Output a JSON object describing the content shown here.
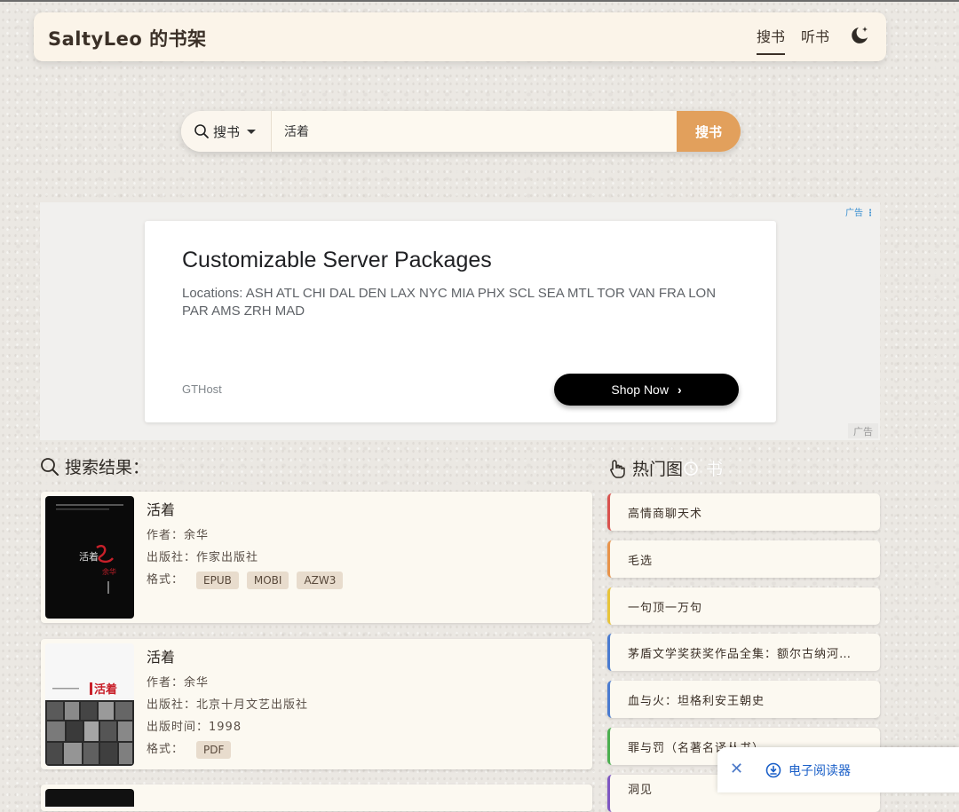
{
  "header": {
    "brand": "SaltyLeo 的书架",
    "nav": [
      {
        "label": "搜书",
        "active": true
      },
      {
        "label": "听书",
        "active": false
      }
    ],
    "theme_icon": "moon-icon"
  },
  "search": {
    "type_label": "搜书",
    "query": "活着",
    "button_label": "搜书"
  },
  "ad": {
    "top_badge": "广告",
    "title": "Customizable Server Packages",
    "description": "Locations: ASH ATL CHI DAL DEN LAX NYC MIA PHX SCL SEA MTL TOR VAN FRA LON PAR AMS ZRH MAD",
    "advertiser": "GTHost",
    "cta": "Shop Now",
    "bottom_badge": "广告"
  },
  "results": {
    "title": "搜索结果：",
    "books": [
      {
        "title": "活着",
        "author": "作者：余华",
        "publisher": "出版社：作家出版社",
        "format_label": "格式：",
        "formats": [
          "EPUB",
          "MOBI",
          "AZW3"
        ],
        "cover": {
          "title": "活着",
          "signature": "余华"
        }
      },
      {
        "title": "活着",
        "author": "作者：余华",
        "publisher": "出版社：北京十月文艺出版社",
        "date": "出版时间：1998",
        "format_label": "格式：",
        "formats": [
          "PDF"
        ],
        "cover": {
          "title": "活着"
        }
      }
    ]
  },
  "hot": {
    "title_main": "热门图",
    "title_faded": "书",
    "items": [
      {
        "label": "高情商聊天术",
        "color": "#d9534f"
      },
      {
        "label": "毛选",
        "color": "#e8934a"
      },
      {
        "label": "一句顶一万句",
        "color": "#e8c43a"
      },
      {
        "label": "茅盾文学奖获奖作品全集：额尔古纳河…",
        "color": "#4a7bd0"
      },
      {
        "label": "血与火：坦格利安王朝史",
        "color": "#4a7bd0"
      },
      {
        "label": "罪与罚（名著名译丛书）",
        "color": "#4caf50"
      },
      {
        "label": "洞见",
        "color": "#7e57c2"
      }
    ]
  },
  "reader_bar": {
    "close_label": "✕",
    "label": "电子阅读器"
  },
  "colors": {
    "accent": "#e2a05c",
    "card_bg": "#fcf9f1",
    "header_bg": "#fbf4e9"
  }
}
